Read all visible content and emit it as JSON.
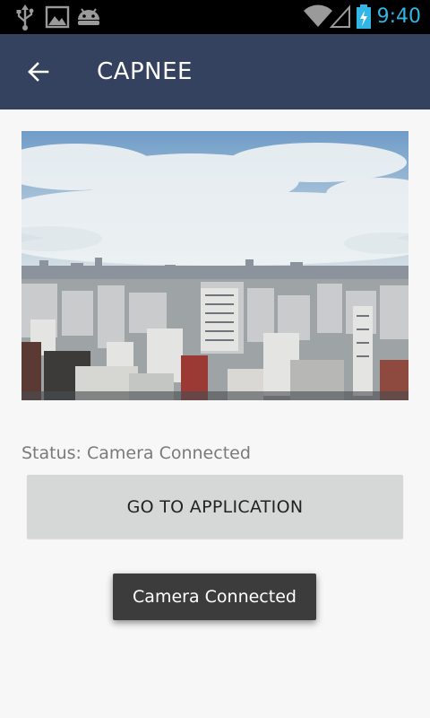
{
  "status_bar": {
    "time": "9:40",
    "left_icons": [
      "usb-icon",
      "image-icon",
      "android-icon"
    ],
    "right_icons": [
      "wifi-icon",
      "signal-icon",
      "battery-charging-icon"
    ],
    "time_color": "#33b5e5"
  },
  "app_bar": {
    "title": "CAPNEE",
    "background": "#34425f",
    "back_icon": "back-arrow-icon"
  },
  "main": {
    "status_text": "Status: Camera Connected",
    "go_button_label": "GO TO APPLICATION"
  },
  "toast": {
    "text": "Camera Connected"
  }
}
